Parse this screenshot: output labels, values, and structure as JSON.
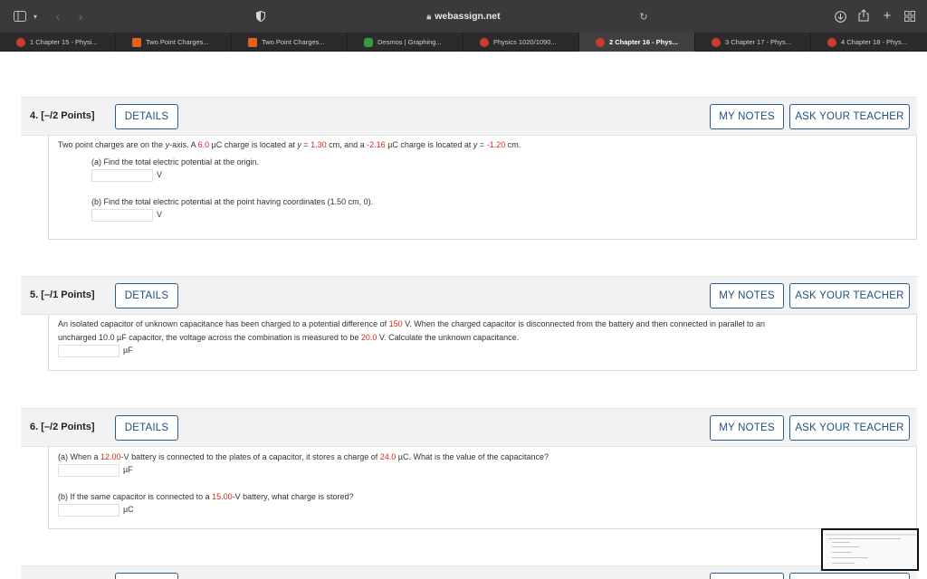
{
  "browser": {
    "url": "webassign.net",
    "tabs": [
      {
        "label": "1 Chapter 15 - Physi...",
        "icon": "webassign-icon"
      },
      {
        "label": "Two Point Charges...",
        "icon": "chegg-icon"
      },
      {
        "label": "Two Point Charges...",
        "icon": "chegg-icon"
      },
      {
        "label": "Desmos | Graphing...",
        "icon": "desmos-icon"
      },
      {
        "label": "Physics 1020/1090...",
        "icon": "webassign-icon"
      },
      {
        "label": "2 Chapter 16 - Phys...",
        "icon": "webassign-icon",
        "active": true
      },
      {
        "label": "3 Chapter 17 - Phys...",
        "icon": "webassign-icon"
      },
      {
        "label": "4 Chapter 18 - Phys...",
        "icon": "webassign-icon"
      }
    ]
  },
  "buttons": {
    "details": "DETAILS",
    "my_notes": "MY NOTES",
    "ask_teacher": "ASK YOUR TEACHER"
  },
  "questions": [
    {
      "header": "4. [–/2 Points]",
      "intro": {
        "t1": "Two point charges are on the ",
        "t2": "y",
        "t3": "-axis. A ",
        "q1": "6.0",
        "t4": " µC charge is located at ",
        "t5": "y",
        "t6": " = ",
        "y1": "1.30",
        "t7": " cm, and a ",
        "q2": "-2.16",
        "t8": " µC charge is located at ",
        "t9": "y",
        "t10": " = ",
        "y2": "-1.20",
        "t11": " cm."
      },
      "part_a": "(a) Find the total electric potential at the origin.",
      "unit_a": "V",
      "part_b": "(b) Find the total electric potential at the point having coordinates (1.50 cm, 0).",
      "unit_b": "V"
    },
    {
      "header": "5. [–/1 Points]",
      "line1_a": "An isolated capacitor of unknown capacitance has been charged to a potential difference of ",
      "v1": "150",
      "line1_b": " V. When the charged capacitor is disconnected from the battery and then connected in parallel to an",
      "line2_a": "uncharged 10.0 µF capacitor, the voltage across the combination is measured to be ",
      "v2": "20.0",
      "line2_b": " V. Calculate the unknown capacitance.",
      "unit": "µF"
    },
    {
      "header": "6. [–/2 Points]",
      "a1": "(a) When a ",
      "v1": "12.00",
      "a2": "-V battery is connected to the plates of a capacitor, it stores a charge of ",
      "q1": "24.0",
      "a3": " µC. What is the value of the capacitance?",
      "unit_a": "µF",
      "b1": "(b) If the same capacitor is connected to a ",
      "v2": "15.00",
      "b2": "-V battery, what charge is stored?",
      "unit_b": "µC"
    }
  ],
  "colors": {
    "accent_red": "#d12b1e",
    "button_blue": "#1f4e80",
    "chrome_dark": "#3a3a3c"
  }
}
